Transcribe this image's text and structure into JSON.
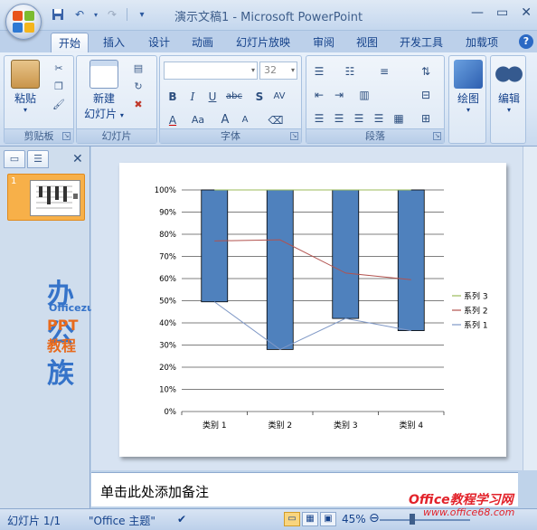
{
  "window": {
    "title": "演示文稿1 - Microsoft PowerPoint",
    "controls": [
      "—",
      "▭",
      "✕"
    ]
  },
  "qat": {
    "items": [
      "save-icon",
      "undo-icon",
      "redo-icon",
      "customize-icon"
    ]
  },
  "tabs": [
    "开始",
    "插入",
    "设计",
    "动画",
    "幻灯片放映",
    "审阅",
    "视图",
    "开发工具",
    "加载项"
  ],
  "ribbon": {
    "clipboard": {
      "label": "剪贴板",
      "paste": "粘贴"
    },
    "slides": {
      "label": "幻灯片",
      "new_slide_line1": "新建",
      "new_slide_line2": "幻灯片"
    },
    "font": {
      "label": "字体",
      "size": "32",
      "bold": "B",
      "italic": "I",
      "underline": "U",
      "strike": "abc",
      "shadow": "S",
      "spacing": "AV",
      "case": "Aa",
      "grow": "A",
      "shrink": "A",
      "color": "A"
    },
    "paragraph": {
      "label": "段落"
    },
    "drawing": {
      "label": "绘图"
    },
    "editing": {
      "label": "编辑"
    }
  },
  "left_panel": {
    "slide_number": "1",
    "watermark_title": "办公族",
    "watermark_url": "Officezu.com",
    "watermark_sub": "PPT教程"
  },
  "chart_data": {
    "type": "bar",
    "categories": [
      "类别 1",
      "类别 2",
      "类别 3",
      "类别 4"
    ],
    "y_ticks": [
      "0%",
      "10%",
      "20%",
      "30%",
      "40%",
      "50%",
      "60%",
      "70%",
      "80%",
      "90%",
      "100%"
    ],
    "ylim": [
      0,
      100
    ],
    "bar_range": [
      [
        49.5,
        100
      ],
      [
        28,
        100
      ],
      [
        42,
        100
      ],
      [
        36.5,
        100
      ]
    ],
    "series": [
      {
        "name": "系列 1",
        "values": [
          49.5,
          28,
          42,
          36.5
        ],
        "color": "#7f98c6"
      },
      {
        "name": "系列 2",
        "values": [
          77,
          77.5,
          62.5,
          59.5
        ],
        "color": "#b2524e"
      },
      {
        "name": "系列 3",
        "values": [
          100,
          100,
          100,
          100
        ],
        "color": "#9bbb59"
      }
    ],
    "bar_color": "#4f81bd",
    "legend": "right",
    "grid": true
  },
  "notes": {
    "placeholder": "单击此处添加备注"
  },
  "status": {
    "slide": "幻灯片 1/1",
    "theme": "\"Office 主题\"",
    "zoom": "45%"
  },
  "watermark_site": {
    "line1": "Office教程学习网",
    "line2": "www.office68.com"
  }
}
